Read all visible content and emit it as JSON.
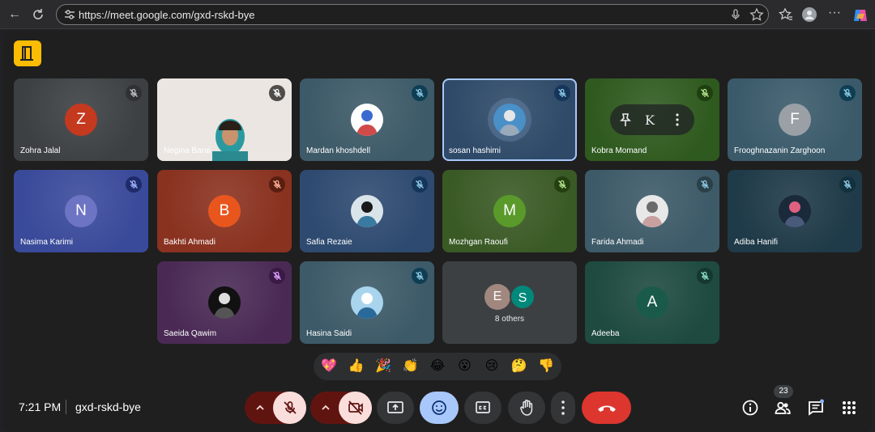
{
  "browser": {
    "url": "https://meet.google.com/gxd-rskd-bye"
  },
  "participants": [
    {
      "name": "Zohra Jalal",
      "initial": "Z",
      "avatar_color": "#c5391f",
      "bg": "#3c4043"
    },
    {
      "name": "Negina Barai",
      "initial": "",
      "avatar_color": "",
      "bg": "#e9e3df"
    },
    {
      "name": "Mardan khoshdell",
      "initial": "",
      "avatar_color": "",
      "bg": "#3d5a68"
    },
    {
      "name": "sosan hashimi",
      "initial": "",
      "avatar_color": "",
      "bg": "#2e4a68"
    },
    {
      "name": "Kobra Momand",
      "initial": "",
      "avatar_color": "",
      "bg": "#2f5a1f"
    },
    {
      "name": "Frooghnazanin Zarghoon",
      "initial": "F",
      "avatar_color": "#9aa0a6",
      "bg": "#3a5a6a"
    },
    {
      "name": "Nasima Karimi",
      "initial": "N",
      "avatar_color": "#6d74c4",
      "bg": "#3a4a9a"
    },
    {
      "name": "Bakhti Ahmadi",
      "initial": "B",
      "avatar_color": "#e8561e",
      "bg": "#8a3220"
    },
    {
      "name": "Safia Rezaie",
      "initial": "",
      "avatar_color": "",
      "bg": "#2e4a70"
    },
    {
      "name": "Mozhgan Raoufi",
      "initial": "M",
      "avatar_color": "#5a9a2a",
      "bg": "#3a5a25"
    },
    {
      "name": "Farida Ahmadi",
      "initial": "",
      "avatar_color": "",
      "bg": "#3d5a68"
    },
    {
      "name": "Adiba Hanifi",
      "initial": "",
      "avatar_color": "",
      "bg": "#1f3a48"
    },
    {
      "name": "Saeida Qawim",
      "initial": "",
      "avatar_color": "",
      "bg": "#4a2a55"
    },
    {
      "name": "Hasina Saidi",
      "initial": "",
      "avatar_color": "",
      "bg": "#3d5a68"
    },
    {
      "name": "Adeeba",
      "initial": "A",
      "avatar_color": "#1a5a4a",
      "bg": "#1e4a40"
    }
  ],
  "others_tile": {
    "label": "8 others",
    "initials": [
      "E",
      "S"
    ],
    "colors": [
      "#a1887f",
      "#00897b"
    ]
  },
  "pinned_menu": {
    "pin_label": "K"
  },
  "reactions": [
    "💖",
    "👍",
    "🎉",
    "👏",
    "😂",
    "😮",
    "😢",
    "🤔",
    "👎"
  ],
  "footer": {
    "time": "7:21 PM",
    "meeting_code": "gxd-rskd-bye",
    "participant_count": "23"
  },
  "colors": {
    "active_outline": "#a8c7fa",
    "end_call": "#dc362e",
    "mic_off_bg": "#f9dedc",
    "caret_bg": "#601410",
    "emoji_active": "#a8c7fa"
  }
}
